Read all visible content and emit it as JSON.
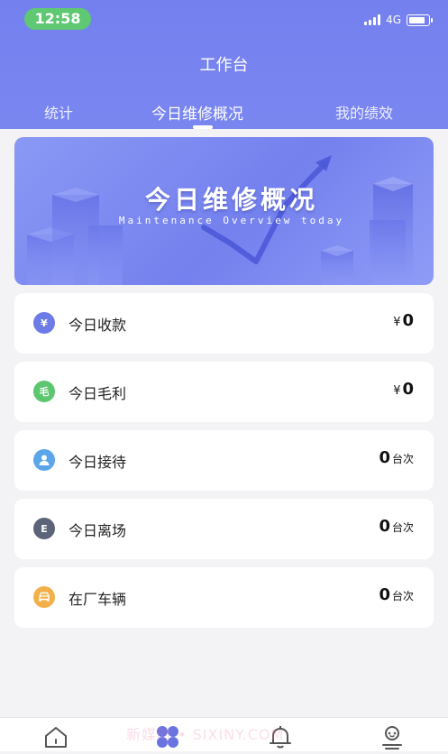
{
  "status_bar": {
    "time": "12:58",
    "network": "4G"
  },
  "header": {
    "title": "工作台",
    "tabs": [
      {
        "label": "统计"
      },
      {
        "label": "今日维修概况",
        "active": true
      },
      {
        "label": "我的绩效"
      }
    ]
  },
  "banner": {
    "title": "今日维修概况",
    "subtitle": "Maintenance Overview today"
  },
  "items": [
    {
      "label": "今日收款",
      "prefix": "¥",
      "value": "0",
      "unit": "",
      "icon_name": "yuan-icon",
      "icon_glyph": "¥",
      "icon_color": "#6c7be6"
    },
    {
      "label": "今日毛利",
      "prefix": "¥",
      "value": "0",
      "unit": "",
      "icon_name": "profit-icon",
      "icon_glyph": "毛",
      "icon_color": "#5cc76f"
    },
    {
      "label": "今日接待",
      "prefix": "",
      "value": "0",
      "unit": "台次",
      "icon_name": "reception-person-icon",
      "icon_glyph": "",
      "icon_color": "#5aa6e8"
    },
    {
      "label": "今日离场",
      "prefix": "",
      "value": "0",
      "unit": "台次",
      "icon_name": "exit-icon",
      "icon_glyph": "E",
      "icon_color": "#5b6478"
    },
    {
      "label": "在厂车辆",
      "prefix": "",
      "value": "0",
      "unit": "台次",
      "icon_name": "car-icon",
      "icon_glyph": "",
      "icon_color": "#f3b04a"
    }
  ],
  "watermark": "新媒时 • SIXINY.COM",
  "tabbar": [
    {
      "name": "home-icon"
    },
    {
      "name": "workbench-icon",
      "active": true
    },
    {
      "name": "bell-icon"
    },
    {
      "name": "profile-icon"
    }
  ],
  "colors": {
    "brand": "#7480ee",
    "active_tab_icon": "#6a74e0"
  }
}
